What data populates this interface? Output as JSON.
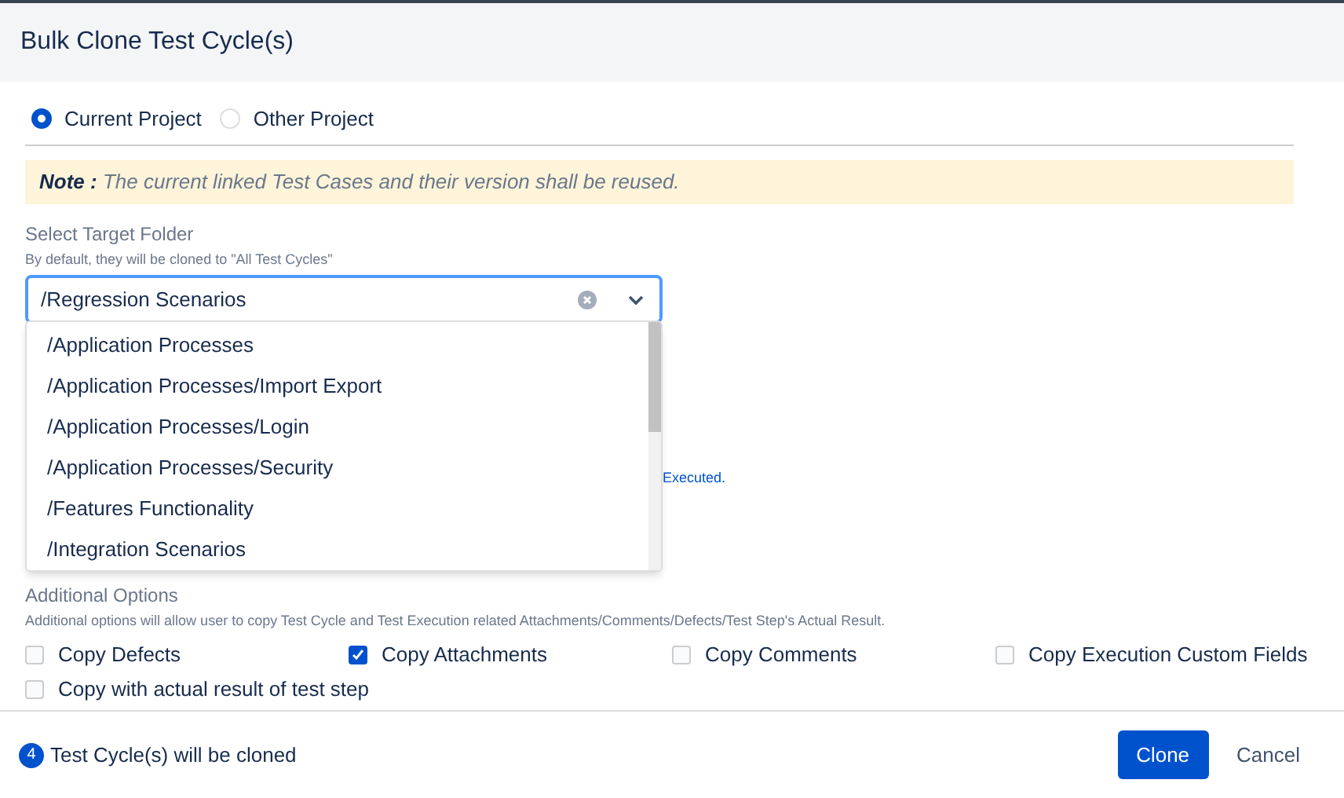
{
  "dialog": {
    "title": "Bulk Clone Test Cycle(s)"
  },
  "project_options": [
    {
      "label": "Current Project",
      "selected": true
    },
    {
      "label": "Other Project",
      "selected": false
    }
  ],
  "note": {
    "label": "Note :",
    "text": "The current linked Test Cases and their version shall be reused."
  },
  "target_folder": {
    "label": "Select Target Folder",
    "hint": "By default, they will be cloned to \"All Test Cycles\"",
    "value": "/Regression Scenarios"
  },
  "folder_dropdown": {
    "options": [
      {
        "label": "/Application Processes"
      },
      {
        "label": "/Application Processes/Import Export"
      },
      {
        "label": "/Application Processes/Login"
      },
      {
        "label": "/Application Processes/Security"
      },
      {
        "label": "/Features Functionality"
      },
      {
        "label": "/Integration Scenarios"
      }
    ]
  },
  "hidden_text_fragment": "Executed.",
  "additional_options": {
    "title": "Additional Options",
    "description": "Additional options will allow user to copy Test Cycle and Test Execution related Attachments/Comments/Defects/Test Step's Actual Result.",
    "options": [
      {
        "label": "Copy Defects",
        "checked": false
      },
      {
        "label": "Copy Attachments",
        "checked": true
      },
      {
        "label": "Copy Comments",
        "checked": false
      },
      {
        "label": "Copy Execution Custom Fields",
        "checked": false
      },
      {
        "label": "Copy with actual result of test step",
        "checked": false
      }
    ]
  },
  "footer": {
    "count": "4",
    "count_text": "Test Cycle(s) will be cloned",
    "buttons": [
      {
        "label": "Clone",
        "kind": "primary"
      },
      {
        "label": "Cancel",
        "kind": "subtle"
      }
    ]
  }
}
